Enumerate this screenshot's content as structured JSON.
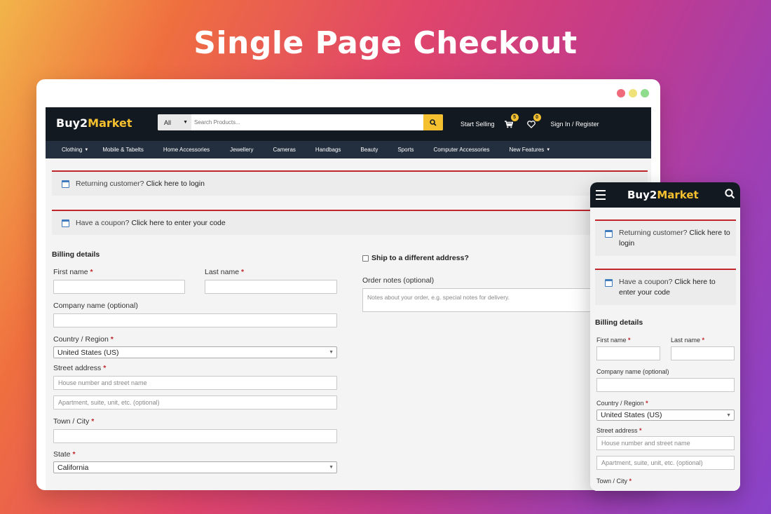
{
  "hero_title": "Single Page Checkout",
  "colors": {
    "dark_nav": "#131921",
    "sub_nav": "#232f3e",
    "accent_yellow": "#f5c02f",
    "notice_red": "#c0262c",
    "dot_red": "#ef6b7b",
    "dot_yellow": "#f0e27a",
    "dot_green": "#8fdc8c"
  },
  "desktop": {
    "logo": {
      "part1": "Buy2",
      "part2": "Market"
    },
    "search": {
      "category": "All",
      "placeholder": "Search Products...",
      "icon": "search-icon"
    },
    "start_selling": "Start Selling",
    "cart_count": "5",
    "wishlist_count": "0",
    "sign_in": "Sign In / Register",
    "categories": [
      "Clothing",
      "Mobile & Tabelts",
      "Home Accessories",
      "Jewellery",
      "Cameras",
      "Handbags",
      "Beauty",
      "Sports",
      "Computer Accessories",
      "New Features"
    ],
    "notice_returning": {
      "text": "Returning customer?",
      "link": "Click here to login"
    },
    "notice_coupon": {
      "text": "Have a coupon?",
      "link": "Click here to enter your code"
    },
    "billing": {
      "title": "Billing details",
      "first_name": "First name",
      "last_name": "Last name",
      "company": "Company name (optional)",
      "country_label": "Country / Region",
      "country_value": "United States (US)",
      "street_label": "Street address",
      "street_placeholder": "House number and street name",
      "street2_placeholder": "Apartment, suite, unit, etc. (optional)",
      "town_label": "Town / City",
      "state_label": "State",
      "state_value": "California",
      "required_mark": "*"
    },
    "ship_different": "Ship to a different address?",
    "order_notes_label": "Order notes (optional)",
    "order_notes_placeholder": "Notes about your order, e.g. special notes for delivery."
  },
  "mobile": {
    "logo": {
      "part1": "Buy2",
      "part2": "Market"
    },
    "notice_returning": {
      "text": "Returning customer?",
      "link": "Click here to login"
    },
    "notice_coupon": {
      "text": "Have a coupon?",
      "link": "Click here to enter your code"
    },
    "billing_title": "Billing details",
    "first_name": "First name",
    "last_name": "Last name",
    "company": "Company name (optional)",
    "country_label": "Country / Region",
    "country_value": "United States (US)",
    "street_label": "Street address",
    "street_placeholder": "House number and street name",
    "street2_placeholder": "Apartment, suite, unit, etc. (optional)",
    "town_label": "Town / City"
  }
}
